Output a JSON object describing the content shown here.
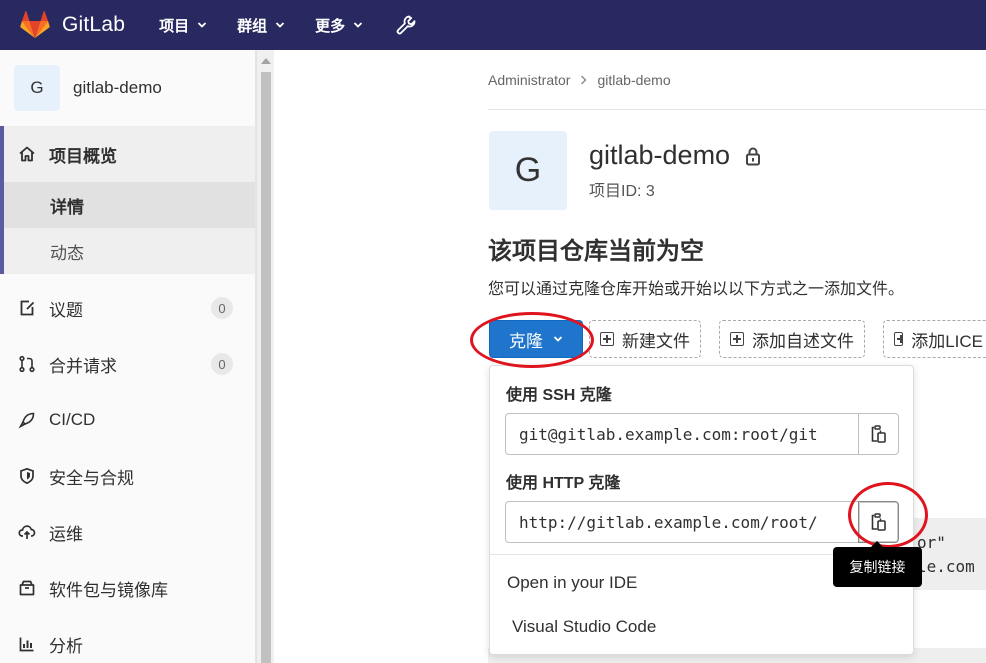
{
  "topnav": {
    "brand": "GitLab",
    "items": [
      "项目",
      "群组",
      "更多"
    ],
    "colors": {
      "bg": "#292961",
      "logo": "#e24329"
    }
  },
  "sidebar": {
    "project_avatar": "G",
    "project_name": "gitlab-demo",
    "overview_label": "项目概览",
    "sub_items": [
      "详情",
      "动态"
    ],
    "items": [
      {
        "label": "议题",
        "count": "0",
        "icon": "issues-icon"
      },
      {
        "label": "合并请求",
        "count": "0",
        "icon": "merge-request-icon"
      },
      {
        "label": "CI/CD",
        "icon": "rocket-icon"
      },
      {
        "label": "安全与合规",
        "icon": "shield-icon"
      },
      {
        "label": "运维",
        "icon": "cloud-icon"
      },
      {
        "label": "软件包与镜像库",
        "icon": "package-icon"
      },
      {
        "label": "分析",
        "icon": "chart-icon"
      }
    ]
  },
  "breadcrumb": [
    "Administrator",
    "gitlab-demo"
  ],
  "project": {
    "avatar": "G",
    "title": "gitlab-demo",
    "id_text": "项目ID: 3"
  },
  "empty_repo": {
    "heading": "该项目仓库当前为空",
    "description": "您可以通过克隆仓库开始或开始以以下方式之一添加文件。"
  },
  "actions": {
    "clone": "克隆",
    "new_file": "新建文件",
    "add_readme": "添加自述文件",
    "add_license": "添加LICE"
  },
  "clone_dropdown": {
    "ssh_label": "使用 SSH 克隆",
    "ssh_url": "git@gitlab.example.com:root/git",
    "http_label": "使用 HTTP 克隆",
    "http_url": "http://gitlab.example.com/root/",
    "ide_section": "Open in your IDE",
    "ide_item": "Visual Studio Code"
  },
  "background_text": {
    "line1": "or\"",
    "line2": "le.com"
  },
  "tooltip": "复制链接",
  "accent": {
    "primary": "#1f75cb",
    "annotation": "#e0141e"
  }
}
